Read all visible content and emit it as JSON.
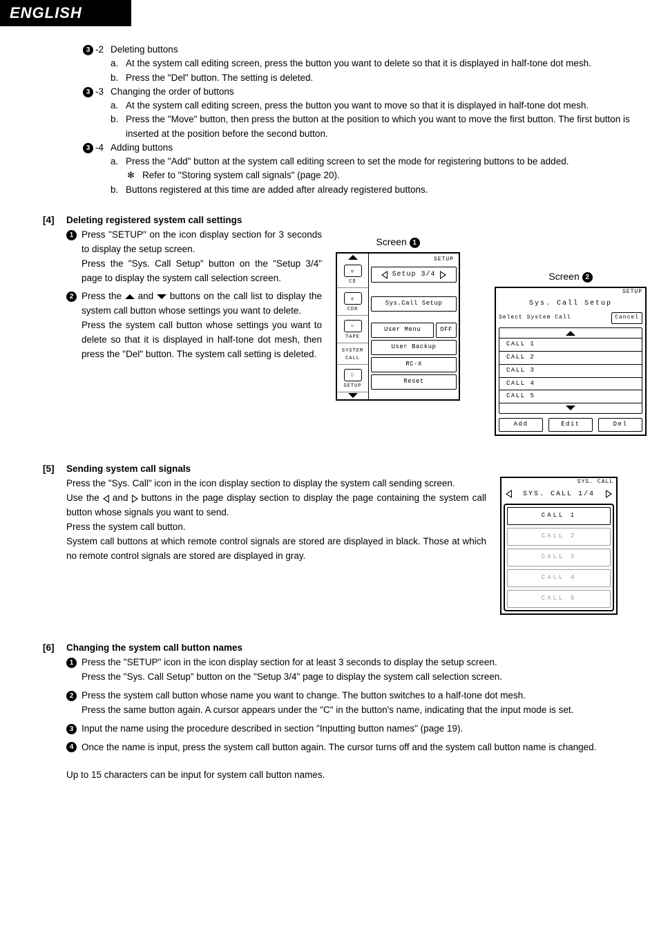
{
  "header": {
    "language": "ENGLISH"
  },
  "section3": {
    "s2": {
      "suffix": "-2",
      "title": "Deleting buttons",
      "a": "At the system call editing screen, press the button you want to delete so that it is displayed in half-tone dot mesh.",
      "b": "Press the \"Del\" button.  The setting is deleted."
    },
    "s3": {
      "suffix": "-3",
      "title": "Changing the order of buttons",
      "a": "At the system call editing screen, press the button you want to move so that it is displayed in half-tone dot mesh.",
      "b": "Press the \"Move\" button, then press the button at the position to which you want to move the first button.  The first button is inserted at the position before the second button."
    },
    "s4": {
      "suffix": "-4",
      "title": "Adding buttons",
      "a": "Press the \"Add\" button at the system call editing screen to set the mode for registering buttons to be added.",
      "note": "Refer to \"Storing system call signals\" (page 20).",
      "b": "Buttons registered at this time are added after already registered buttons."
    }
  },
  "section4": {
    "num": "[4]",
    "title": "Deleting registered system call settings",
    "step1a": "Press \"SETUP\" on the icon display section for 3 seconds to display the setup screen.",
    "step1b": "Press the \"Sys. Call Setup\" button on the \"Setup 3/4\" page to display the system call selection screen.",
    "step2_pre": "Press the",
    "step2_mid": "and",
    "step2_post": "buttons on the call list to display the system call button whose settings you want to delete.",
    "step2b": "Press the system call button whose settings you want to delete so that it is displayed in half-tone dot mesh, then press the \"Del\" button.  The system call setting is deleted.",
    "screen1": {
      "label_prefix": "Screen",
      "top": "SETUP",
      "nav": "Setup 3/4",
      "left": {
        "cd": "CD",
        "cdr": "CDR",
        "tape": "TAPE",
        "syscall": "SYSTEM CALL",
        "setup": "SETUP"
      },
      "buttons": {
        "syscall": "Sys.Call Setup",
        "usermenu": "User Menu",
        "off": "OFF",
        "userbackup": "User Backup",
        "rcx": "RC-X",
        "reset": "Reset"
      }
    },
    "screen2": {
      "label_prefix": "Screen",
      "top": "SETUP",
      "title": "Sys. Call Setup",
      "subtitle": "Select System Call",
      "cancel": "Cancel",
      "calls": [
        "CALL  1",
        "CALL  2",
        "CALL  3",
        "CALL  4",
        "CALL  5"
      ],
      "add": "Add",
      "edit": "Edit",
      "del": "Del"
    }
  },
  "section5": {
    "num": "[5]",
    "title": "Sending system call signals",
    "p1": "Press the \"Sys. Call\" icon in the icon display section to display the system call sending screen.",
    "p2_pre": "Use the",
    "p2_mid": "and",
    "p2_post": "buttons in the page display section to display the page containing the system call button whose signals you want to send.",
    "p3": "Press the system call button.",
    "p4": "System call buttons at which remote control signals are stored are displayed in black.  Those at which no remote control signals are stored are displayed in gray.",
    "screen3": {
      "top": "SYS. CALL",
      "nav": "SYS. CALL  1/4",
      "calls": [
        "CALL  1",
        "CALL  2",
        "CALL  3",
        "CALL  4",
        "CALL  5"
      ]
    }
  },
  "section6": {
    "num": "[6]",
    "title": "Changing the system call button names",
    "step1a": "Press the \"SETUP\" icon in the icon display section for at least 3 seconds to display the setup screen.",
    "step1b": "Press the \"Sys. Call Setup\" button on the \"Setup 3/4\" page to display the system call selection screen.",
    "step2a": "Press the system call button whose name you want to change.  The button switches to a half-tone dot mesh.",
    "step2b": "Press the same button again.  A cursor appears under the \"C\" in the button's name, indicating that the input mode is set.",
    "step3": "Input the name using the procedure described in section \"Inputting button names\" (page 19).",
    "step4": "Once the name is input, press the system call button again.  The cursor turns off and the system call button name is changed.",
    "footer": "Up to 15 characters can be input for system call button names."
  }
}
